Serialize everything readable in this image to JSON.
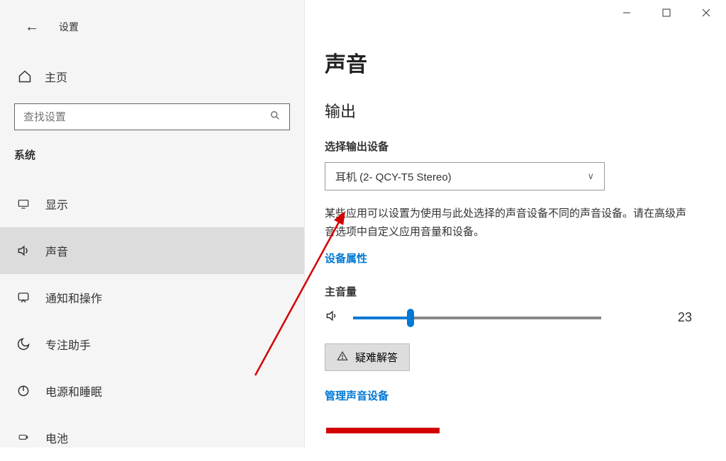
{
  "header": {
    "title": "设置"
  },
  "sidebar": {
    "home": "主页",
    "search_placeholder": "查找设置",
    "category": "系统",
    "items": [
      {
        "label": "显示",
        "icon": "display"
      },
      {
        "label": "声音",
        "icon": "sound"
      },
      {
        "label": "通知和操作",
        "icon": "notify"
      },
      {
        "label": "专注助手",
        "icon": "focus"
      },
      {
        "label": "电源和睡眠",
        "icon": "power"
      },
      {
        "label": "电池",
        "icon": "battery"
      }
    ]
  },
  "main": {
    "title": "声音",
    "output": {
      "section": "输出",
      "select_label": "选择输出设备",
      "device": "耳机 (2- QCY-T5 Stereo)",
      "desc": "某些应用可以设置为使用与此处选择的声音设备不同的声音设备。请在高级声音选项中自定义应用音量和设备。",
      "props_link": "设备属性",
      "volume_label": "主音量",
      "volume_value": "23",
      "troubleshoot": "疑难解答",
      "manage_link": "管理声音设备"
    }
  }
}
